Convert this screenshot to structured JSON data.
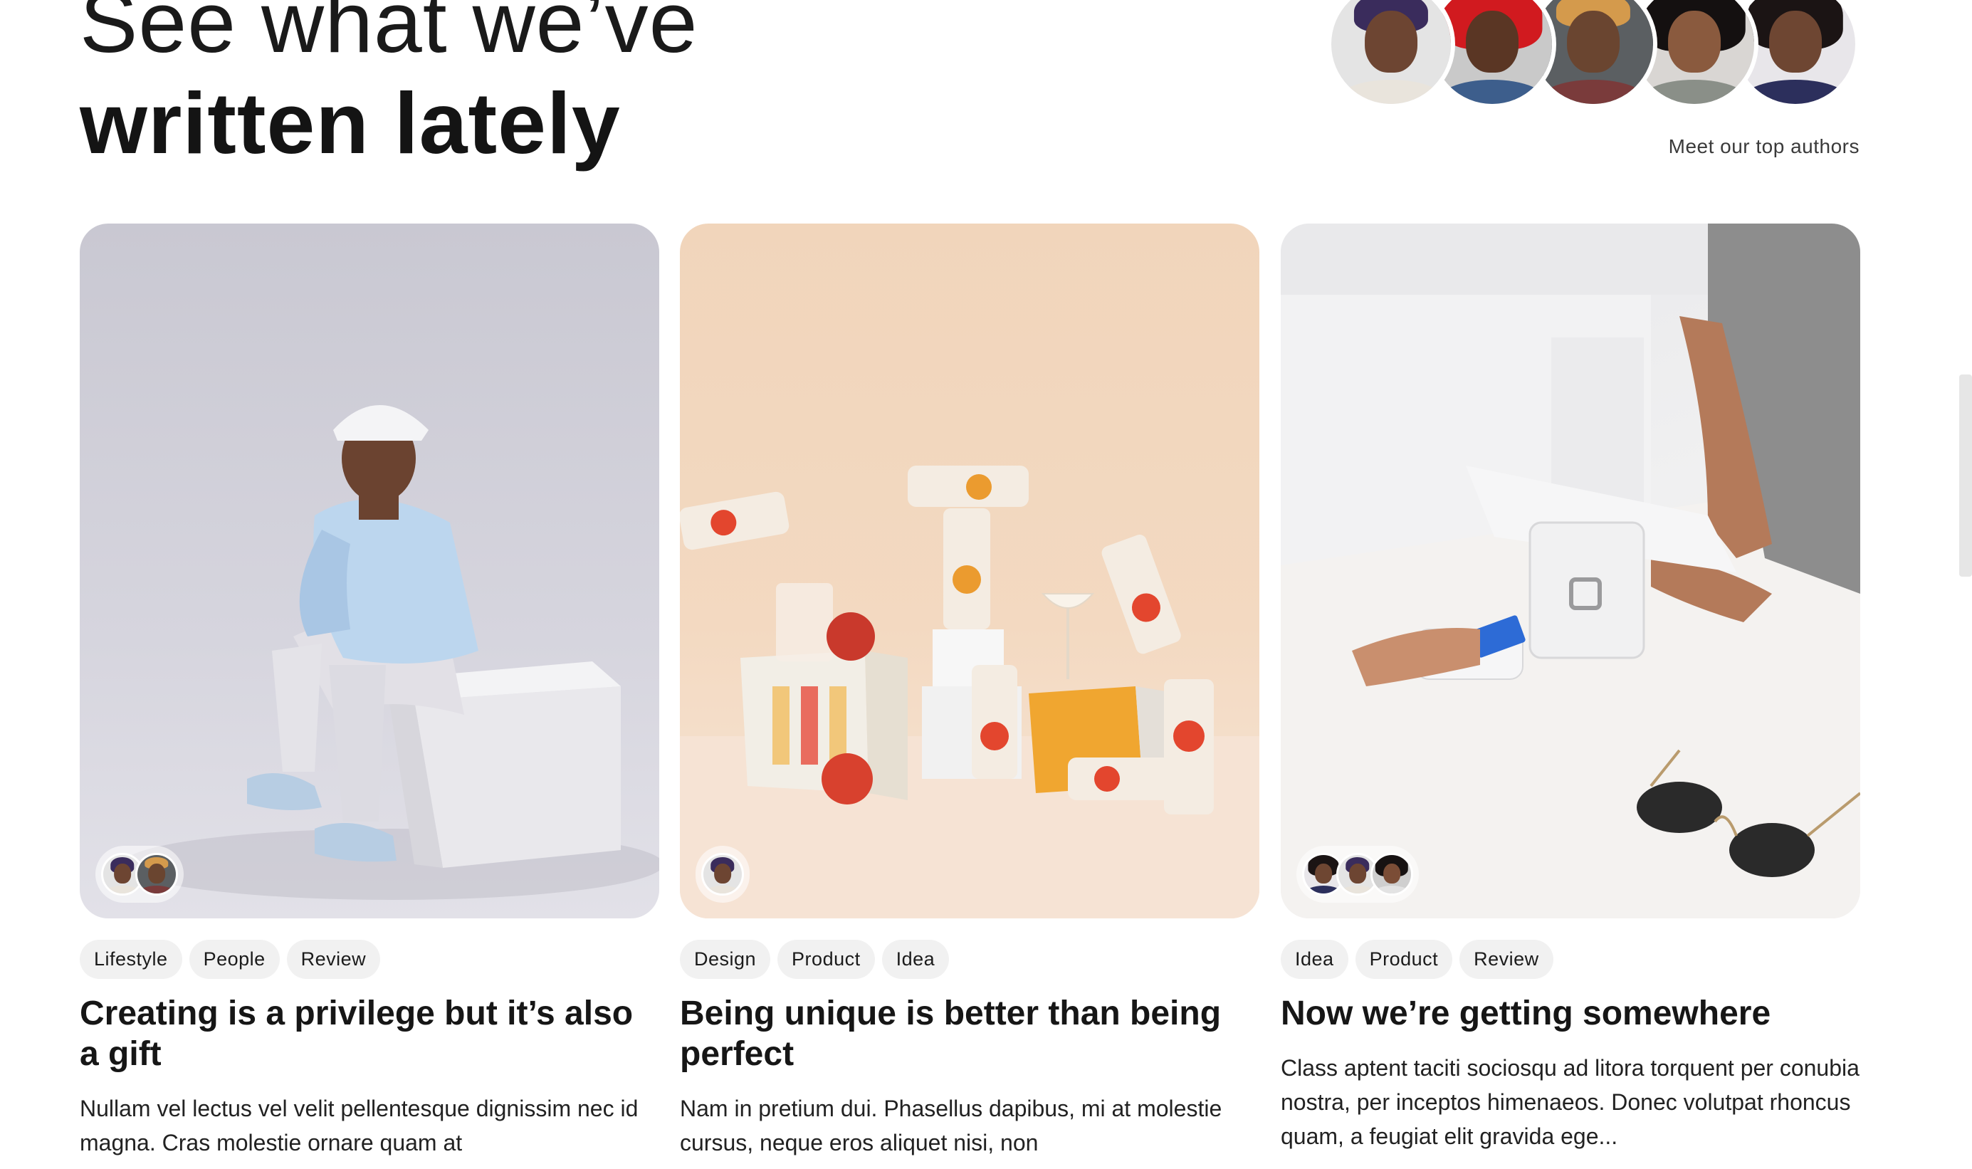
{
  "header": {
    "headline_light": "See what we’ve",
    "headline_bold": "written lately",
    "authors_link": "Meet our top authors"
  },
  "posts": [
    {
      "tags": [
        "Lifestyle",
        "People",
        "Review"
      ],
      "title": "Creating is a privilege but it’s also a gift",
      "excerpt": "Nullam vel lectus vel velit pellentesque dignissim nec id magna. Cras molestie ornare quam at"
    },
    {
      "tags": [
        "Design",
        "Product",
        "Idea"
      ],
      "title": "Being unique is better than being perfect",
      "excerpt": "Nam in pretium dui. Phasellus dapibus, mi at molestie cursus, neque eros aliquet nisi, non"
    },
    {
      "tags": [
        "Idea",
        "Product",
        "Review"
      ],
      "title": "Now we’re getting somewhere",
      "excerpt": "Class aptent taciti sociosqu ad litora torquent per conubia nostra, per inceptos himenaeos. Donec volutpat rhoncus quam, a feugiat elit gravida ege..."
    }
  ],
  "colors": {
    "tag_background": "#f1f1f1",
    "text_primary": "#161616",
    "card1_background": "#d6d5de",
    "card2_background": "#f3d9c1",
    "card3_background": "#ededee"
  }
}
